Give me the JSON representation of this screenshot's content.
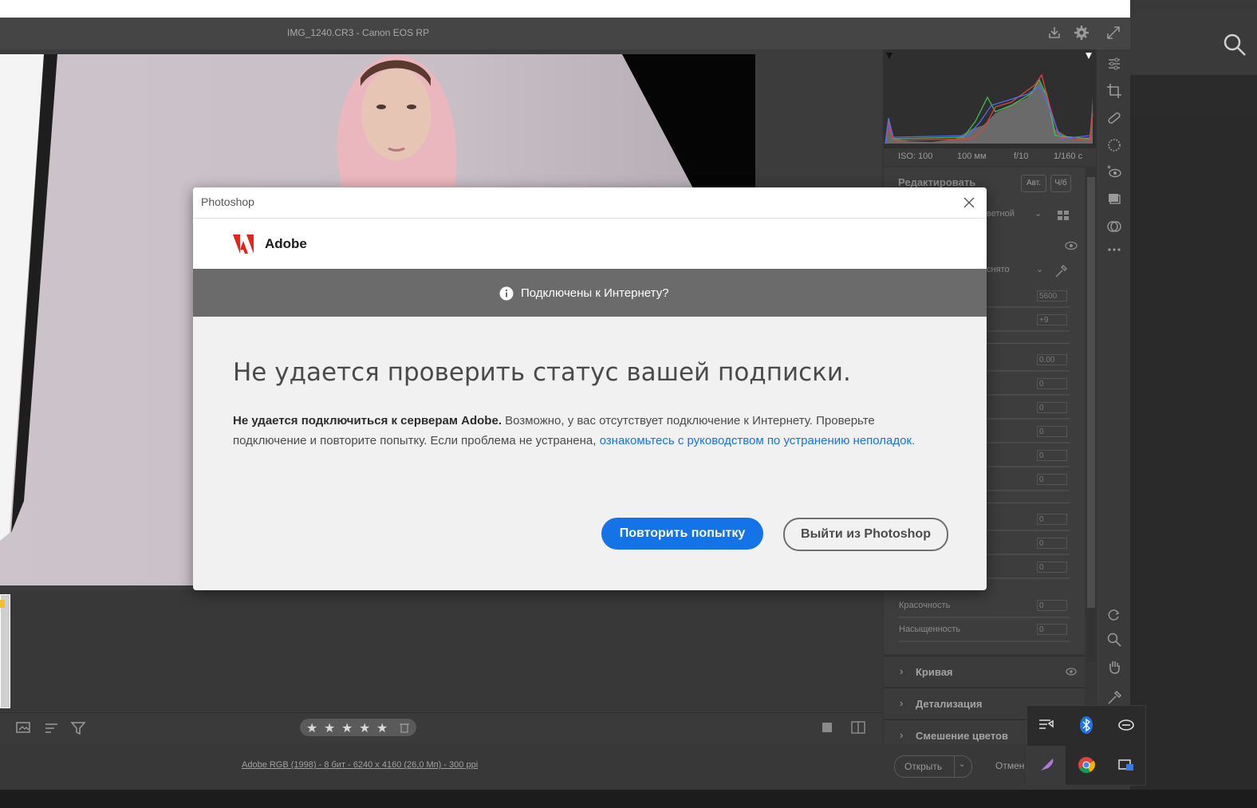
{
  "window": {
    "title": "IMG_1240.CR3  -  Canon EOS RP"
  },
  "exif": {
    "iso": "ISO: 100",
    "focal": "100 мм",
    "aperture": "f/10",
    "shutter": "1/160 с"
  },
  "edit_panel": {
    "title": "Редактировать",
    "auto_label": "Авт.",
    "bw_label": "Ч/б",
    "profile_partial": "ветной",
    "wb_partial": "снято",
    "values": [
      "5600",
      "+9",
      "0.00",
      "0",
      "0",
      "0",
      "0",
      "0",
      "0",
      "0",
      "0"
    ],
    "vibrance_label": "Красочность",
    "vibrance_value": "0",
    "saturation_label": "Насыщенность",
    "saturation_value": "0"
  },
  "sections": [
    {
      "label": "Кривая"
    },
    {
      "label": "Детализация"
    },
    {
      "label": "Смешение цветов"
    }
  ],
  "footer": {
    "info": "Adobe RGB (1998) - 8 бит - 6240 x 4160 (26,0 Мп) - 300 ppi",
    "open_label": "Открыть",
    "cancel_partial": "Отмен"
  },
  "rating": {
    "stars": [
      "★",
      "★",
      "★",
      "★",
      "★"
    ]
  },
  "dialog": {
    "title": "Photoshop",
    "brand": "Adobe",
    "banner": "Подключены к Интернету?",
    "heading": "Не удается проверить статус вашей подписки.",
    "body_bold": "Не удается подключиться к серверам Adobe.",
    "body_text": " Возможно, у вас отсутствует подключение к Интернету. Проверьте подключение и повторите попытку. Если проблема не устранена, ",
    "body_link": "ознакомьтесь с руководством по устранению неполадок",
    "body_end": ".",
    "retry_label": "Повторить попытку",
    "quit_label": "Выйти из Photoshop"
  },
  "colors": {
    "accent": "#1473e6",
    "banner": "#6b6b6b",
    "adobe_red": "#e1251b"
  }
}
